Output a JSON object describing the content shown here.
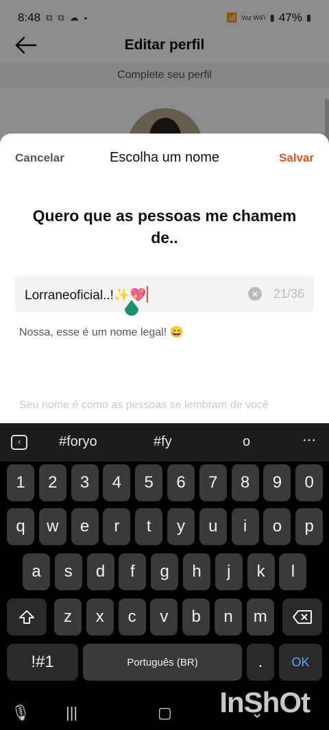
{
  "status_bar": {
    "time": "8:48",
    "indicators": [
      "screenshot-icon",
      "screenshot-icon",
      "cloud-icon",
      "dot-icon"
    ],
    "wifi_label": "Voz WiFi",
    "battery": "47%"
  },
  "background_page": {
    "title": "Editar perfil",
    "subtitle": "Complete seu perfil"
  },
  "sheet": {
    "cancel_label": "Cancelar",
    "title": "Escolha um nome",
    "save_label": "Salvar",
    "question": "Quero que as pessoas me chamem de..",
    "name_value": "Lorraneoficial..!✨💖",
    "counter": "21/36",
    "hint_good": "Nossa, esse é um nome legal! 😄",
    "hint_name": "Seu nome é como as pessoas se lembram de você",
    "accent_color": "#e2531b"
  },
  "keyboard": {
    "suggestions": [
      "#foryo",
      "#fy",
      "o"
    ],
    "more_label": "⋯",
    "row_numbers": [
      "1",
      "2",
      "3",
      "4",
      "5",
      "6",
      "7",
      "8",
      "9",
      "0"
    ],
    "row1": [
      "q",
      "w",
      "e",
      "r",
      "t",
      "y",
      "u",
      "i",
      "o",
      "p"
    ],
    "row2": [
      "a",
      "s",
      "d",
      "f",
      "g",
      "h",
      "j",
      "k",
      "l"
    ],
    "row3": [
      "z",
      "x",
      "c",
      "v",
      "b",
      "n",
      "m"
    ],
    "symbols_label": "!#1",
    "space_label": "Português (BR)",
    "period_label": ".",
    "ok_label": "OK"
  },
  "watermark": "InShOt"
}
